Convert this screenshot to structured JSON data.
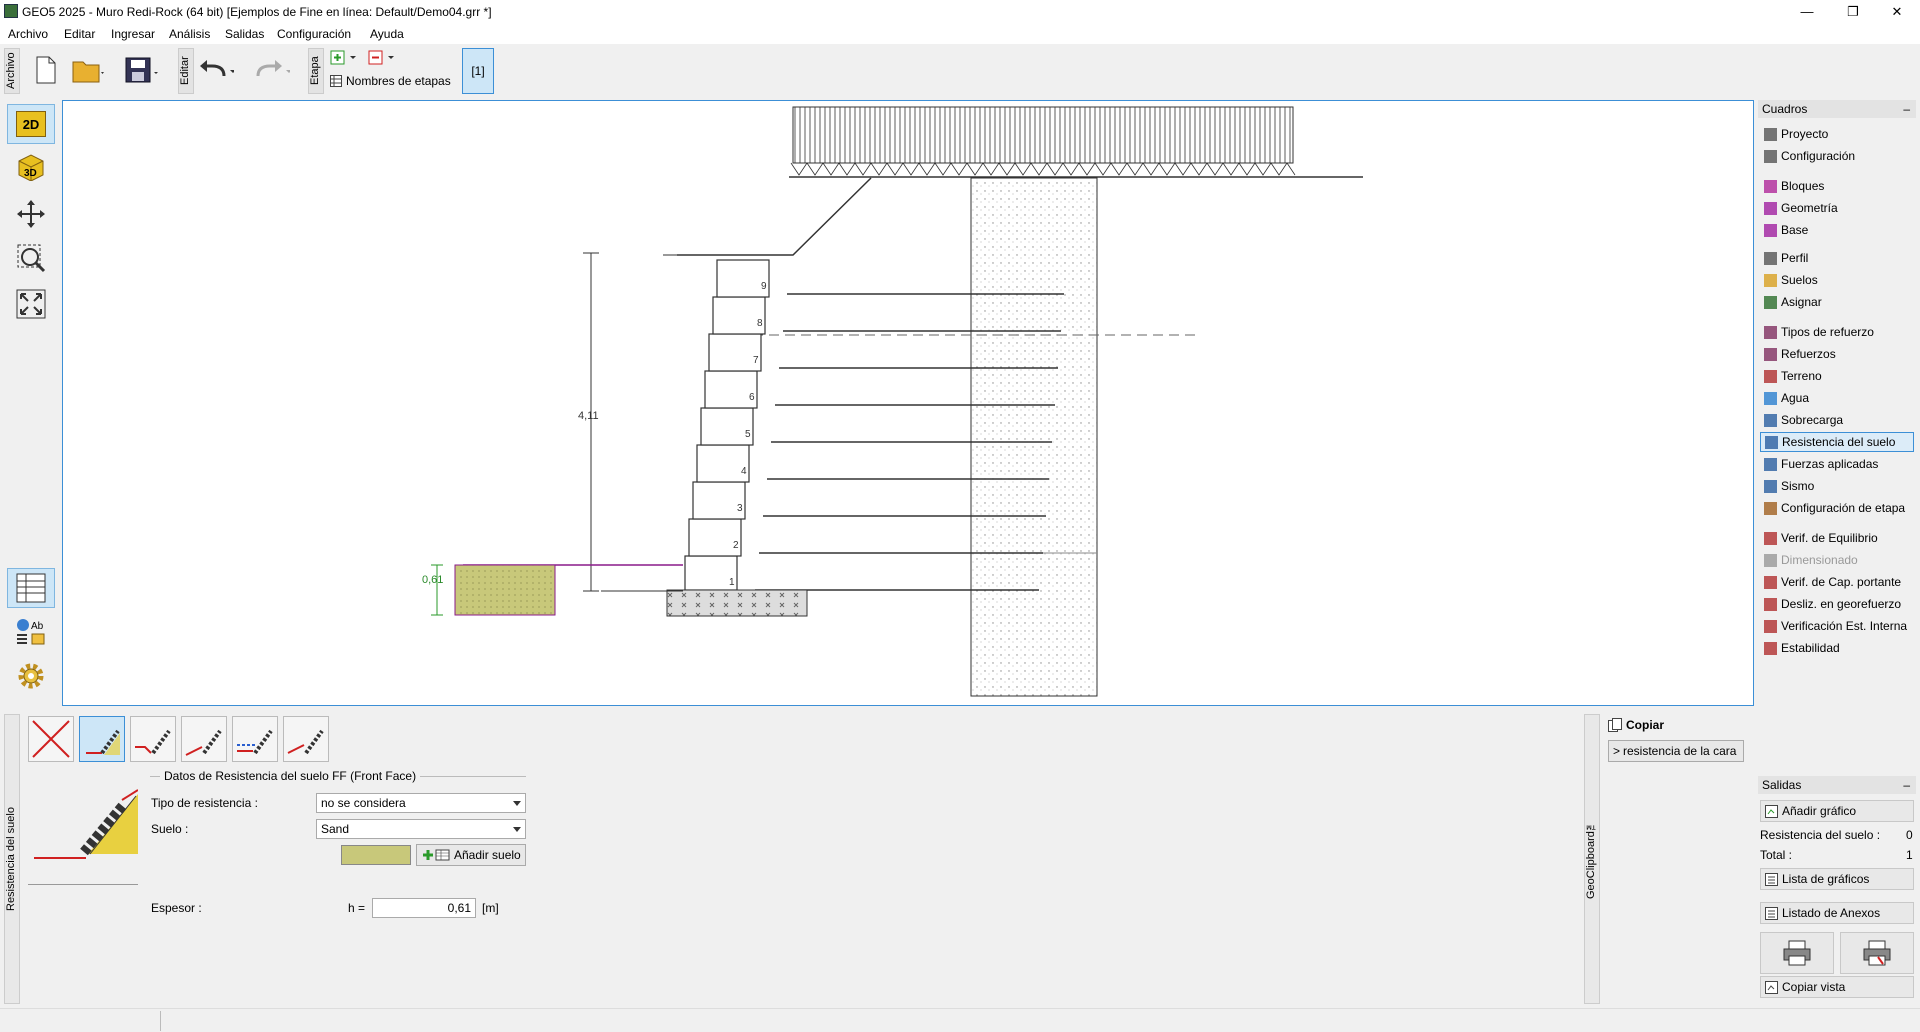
{
  "window": {
    "title": "GEO5 2025 - Muro Redi-Rock  (64 bit) [Ejemplos de Fine en línea: Default/Demo04.grr *]",
    "minimize": "—",
    "maximize": "❐",
    "close": "✕"
  },
  "menu": [
    "Archivo",
    "Editar",
    "Ingresar",
    "Análisis",
    "Salidas",
    "Configuración",
    "Ayuda"
  ],
  "toolbar": {
    "archivo_tab": "Archivo",
    "editar_tab": "Editar",
    "etapa_tab": "Etapa",
    "stage_names_label": "Nombres de etapas",
    "stage_button": "[1]"
  },
  "left_tools": {
    "btn_2d": "2D",
    "btn_3d": "3D"
  },
  "drawing": {
    "height_dim": "4,11",
    "soil_thickness_dim": "0,61",
    "layers": [
      "1",
      "2",
      "3",
      "4",
      "5",
      "6",
      "7",
      "8",
      "9"
    ]
  },
  "cuadros": {
    "title": "Cuadros",
    "collapse": "–",
    "items": [
      {
        "label": "Proyecto",
        "icon": "project-icon",
        "color": "#555555"
      },
      {
        "label": "Configuración",
        "icon": "gear-icon",
        "color": "#555555"
      },
      {
        "label": "Bloques",
        "icon": "blocks-icon",
        "color": "#b0289a"
      },
      {
        "label": "Geometría",
        "icon": "geometry-icon",
        "color": "#a020a0"
      },
      {
        "label": "Base",
        "icon": "base-icon",
        "color": "#a020a0"
      },
      {
        "label": "Perfil",
        "icon": "profile-icon",
        "color": "#555555"
      },
      {
        "label": "Suelos",
        "icon": "soils-icon",
        "color": "#d8a020"
      },
      {
        "label": "Asignar",
        "icon": "assign-icon",
        "color": "#2c6e2c"
      },
      {
        "label": "Tipos de refuerzo",
        "icon": "reinforcement-types-icon",
        "color": "#803060"
      },
      {
        "label": "Refuerzos",
        "icon": "reinforcements-icon",
        "color": "#803060"
      },
      {
        "label": "Terreno",
        "icon": "terrain-icon",
        "color": "#b03030"
      },
      {
        "label": "Agua",
        "icon": "water-icon",
        "color": "#2a7fd0"
      },
      {
        "label": "Sobrecarga",
        "icon": "surcharge-icon",
        "color": "#2a5fa0"
      },
      {
        "label": "Resistencia del suelo",
        "icon": "soil-resistance-icon",
        "color": "#2a5fa0"
      },
      {
        "label": "Fuerzas aplicadas",
        "icon": "applied-forces-icon",
        "color": "#2a5fa0"
      },
      {
        "label": "Sismo",
        "icon": "earthquake-icon",
        "color": "#2a5fa0"
      },
      {
        "label": "Configuración de etapa",
        "icon": "stage-settings-icon",
        "color": "#a06020"
      },
      {
        "label": "Verif. de Equilibrio",
        "icon": "equilibrium-icon",
        "color": "#b03030"
      },
      {
        "label": "Dimensionado",
        "icon": "dimensioning-icon",
        "color": "#999999"
      },
      {
        "label": "Verif. de Cap. portante",
        "icon": "bearing-capacity-icon",
        "color": "#b03030"
      },
      {
        "label": "Desliz. en georefuerzo",
        "icon": "geo-slip-icon",
        "color": "#b03030"
      },
      {
        "label": "Verificación Est. Interna",
        "icon": "internal-stability-icon",
        "color": "#b03030"
      },
      {
        "label": "Estabilidad",
        "icon": "stability-icon",
        "color": "#b03030"
      }
    ]
  },
  "salidas": {
    "title": "Salidas",
    "collapse": "–",
    "add_graph": "Añadir gráfico",
    "soil_res_label": "Resistencia del suelo :",
    "soil_res_value": "0",
    "total_label": "Total :",
    "total_value": "1",
    "graph_list": "Lista de gráficos",
    "annex_list": "Listado de Anexos",
    "copy_view": "Copiar vista"
  },
  "bottom": {
    "side_tab": "Resistencia del suelo",
    "group_title": "Datos de Resistencia del suelo FF (Front Face)",
    "resistance_type_label": "Tipo de resistencia :",
    "resistance_type_value": "no se considera",
    "soil_label": "Suelo :",
    "soil_value": "Sand",
    "add_soil": "Añadir suelo",
    "thickness_label": "Espesor :",
    "h_label": "h =",
    "h_value": "0,61",
    "unit": "[m]"
  },
  "clipboard": {
    "side_tab": "GeoClipboard™",
    "copy": "Copiar",
    "item": "resistencia de la cara"
  },
  "colors": {
    "accent": "#3c8fd6",
    "soil_fill": "#c8c87a",
    "wall_fill": "#e4e4e4"
  }
}
